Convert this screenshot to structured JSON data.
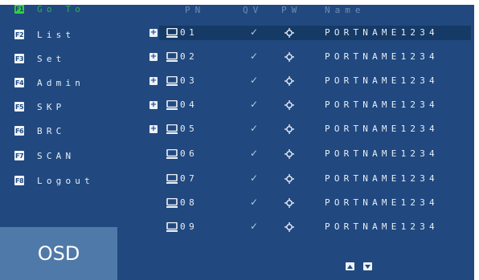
{
  "sidebar": {
    "items": [
      {
        "key": "F1",
        "label": "Go To",
        "active": true
      },
      {
        "key": "F2",
        "label": "List"
      },
      {
        "key": "F3",
        "label": "Set"
      },
      {
        "key": "F4",
        "label": "Admin"
      },
      {
        "key": "F5",
        "label": "SKP"
      },
      {
        "key": "F6",
        "label": "BRC"
      },
      {
        "key": "F7",
        "label": "SCAN"
      },
      {
        "key": "F8",
        "label": "Logout"
      }
    ]
  },
  "table": {
    "headers": {
      "pn": "PN",
      "qv": "QV",
      "pw": "PW",
      "name": "Name"
    },
    "rows": [
      {
        "expand": "+",
        "pn": "01",
        "qv": "✓",
        "name": "PORTNAME1234"
      },
      {
        "expand": "+",
        "pn": "02",
        "qv": "✓",
        "name": "PORTNAME1234"
      },
      {
        "expand": "+",
        "pn": "03",
        "qv": "✓",
        "name": "PORTNAME1234"
      },
      {
        "expand": "+",
        "pn": "04",
        "qv": "✓",
        "name": "PORTNAME1234"
      },
      {
        "expand": "+",
        "pn": "05",
        "qv": "✓",
        "name": "PORTNAME1234"
      },
      {
        "expand": "",
        "pn": "06",
        "qv": "✓",
        "name": "PORTNAME1234"
      },
      {
        "expand": "",
        "pn": "07",
        "qv": "✓",
        "name": "PORTNAME1234"
      },
      {
        "expand": "",
        "pn": "08",
        "qv": "✓",
        "name": "PORTNAME1234"
      },
      {
        "expand": "",
        "pn": "09",
        "qv": "✓",
        "name": "PORTNAME1234"
      }
    ]
  },
  "osd_label": "OSD",
  "icons": {
    "row_device": "monitor-icon",
    "row_settings": "gear-icon",
    "page_up": "up-arrow-icon",
    "page_down": "down-arrow-icon"
  },
  "colors": {
    "background": "#21497f",
    "selected_row": "#163a66",
    "active_key": "#2fd33a",
    "osd_box": "#4f79a8"
  }
}
